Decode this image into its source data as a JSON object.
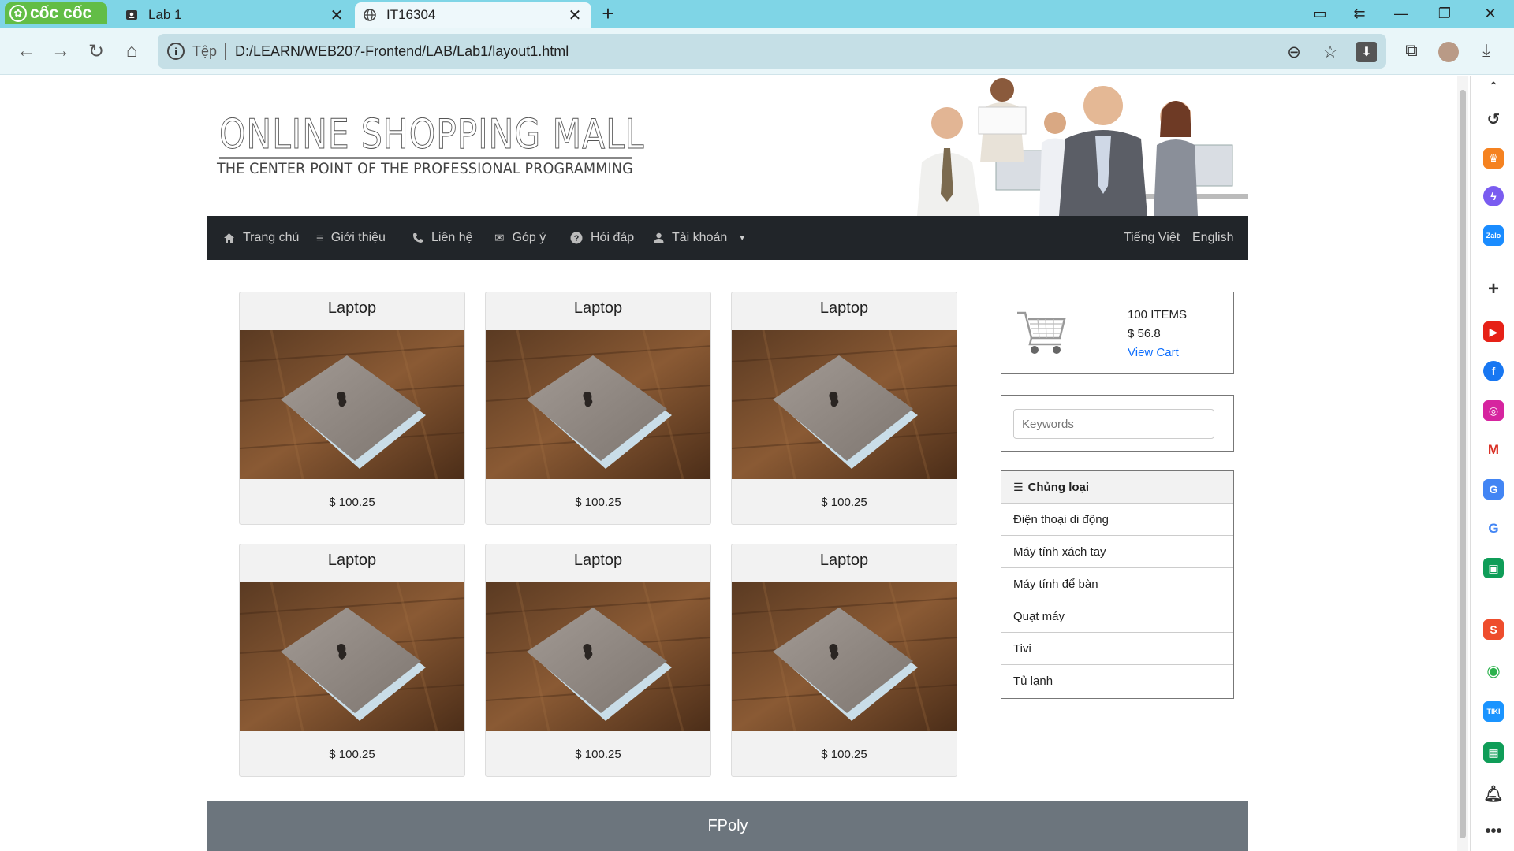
{
  "browser": {
    "logo_text": "cốc cốc",
    "tabs": [
      {
        "title": "Lab 1",
        "active": false
      },
      {
        "title": "IT16304",
        "active": true
      }
    ],
    "address": {
      "scheme_label": "Tệp",
      "url": "D:/LEARN/WEB207-Frontend/LAB/Lab1/layout1.html"
    }
  },
  "site": {
    "title": "ONLINE SHOPPING MALL",
    "slogan": "THE CENTER POINT OF THE PROFESSIONAL PROGRAMMING"
  },
  "menu": {
    "items": [
      {
        "label": "Trang chủ",
        "icon": "home-icon"
      },
      {
        "label": "Giới thiệu",
        "icon": "list-icon"
      },
      {
        "label": "Liên hệ",
        "icon": "phone-icon"
      },
      {
        "label": "Góp ý",
        "icon": "envelope-icon"
      },
      {
        "label": "Hỏi đáp",
        "icon": "question-icon"
      },
      {
        "label": "Tài khoản",
        "icon": "user-icon"
      }
    ],
    "languages": [
      "Tiếng Việt",
      "English"
    ]
  },
  "products": [
    {
      "name": "Laptop",
      "price": "$ 100.25"
    },
    {
      "name": "Laptop",
      "price": "$ 100.25"
    },
    {
      "name": "Laptop",
      "price": "$ 100.25"
    },
    {
      "name": "Laptop",
      "price": "$ 100.25"
    },
    {
      "name": "Laptop",
      "price": "$ 100.25"
    },
    {
      "name": "Laptop",
      "price": "$ 100.25"
    }
  ],
  "cart": {
    "items": "100 ITEMS",
    "total": "$ 56.8",
    "link": "View Cart"
  },
  "search": {
    "placeholder": "Keywords"
  },
  "categories": {
    "heading": "Chủng loại",
    "items": [
      "Điện thoại di động",
      "Máy tính xách tay",
      "Máy tính để bàn",
      "Quạt máy",
      "Tivi",
      "Tủ lạnh"
    ]
  },
  "footer": {
    "text": "FPoly"
  },
  "colors": {
    "tab_bar": "#7fd5e6",
    "menu_bg": "#212529",
    "footer_bg": "#6c757d",
    "link": "#0d6efd"
  }
}
